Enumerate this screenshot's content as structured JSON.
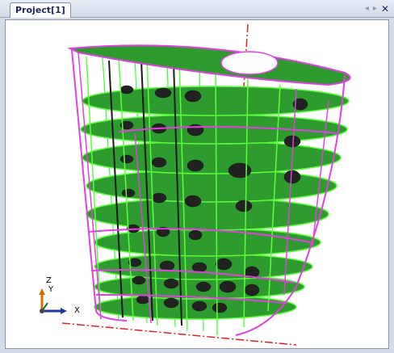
{
  "window": {
    "tab_label": "Project[1]",
    "controls": {
      "prev_symbol": "◂",
      "next_symbol": "▸",
      "close_symbol": "✕"
    }
  },
  "viewport": {
    "background": "#ffffff",
    "model": {
      "description_colors": {
        "plate_fill": "#2e9b2e",
        "plate_edge": "#5aff3a",
        "frame_line": "#e040e0",
        "hole_fill": "#222222",
        "centerline": "#e02020"
      }
    },
    "triad": {
      "z_label": "Z",
      "y_label": "Y",
      "x_label": "X"
    }
  }
}
